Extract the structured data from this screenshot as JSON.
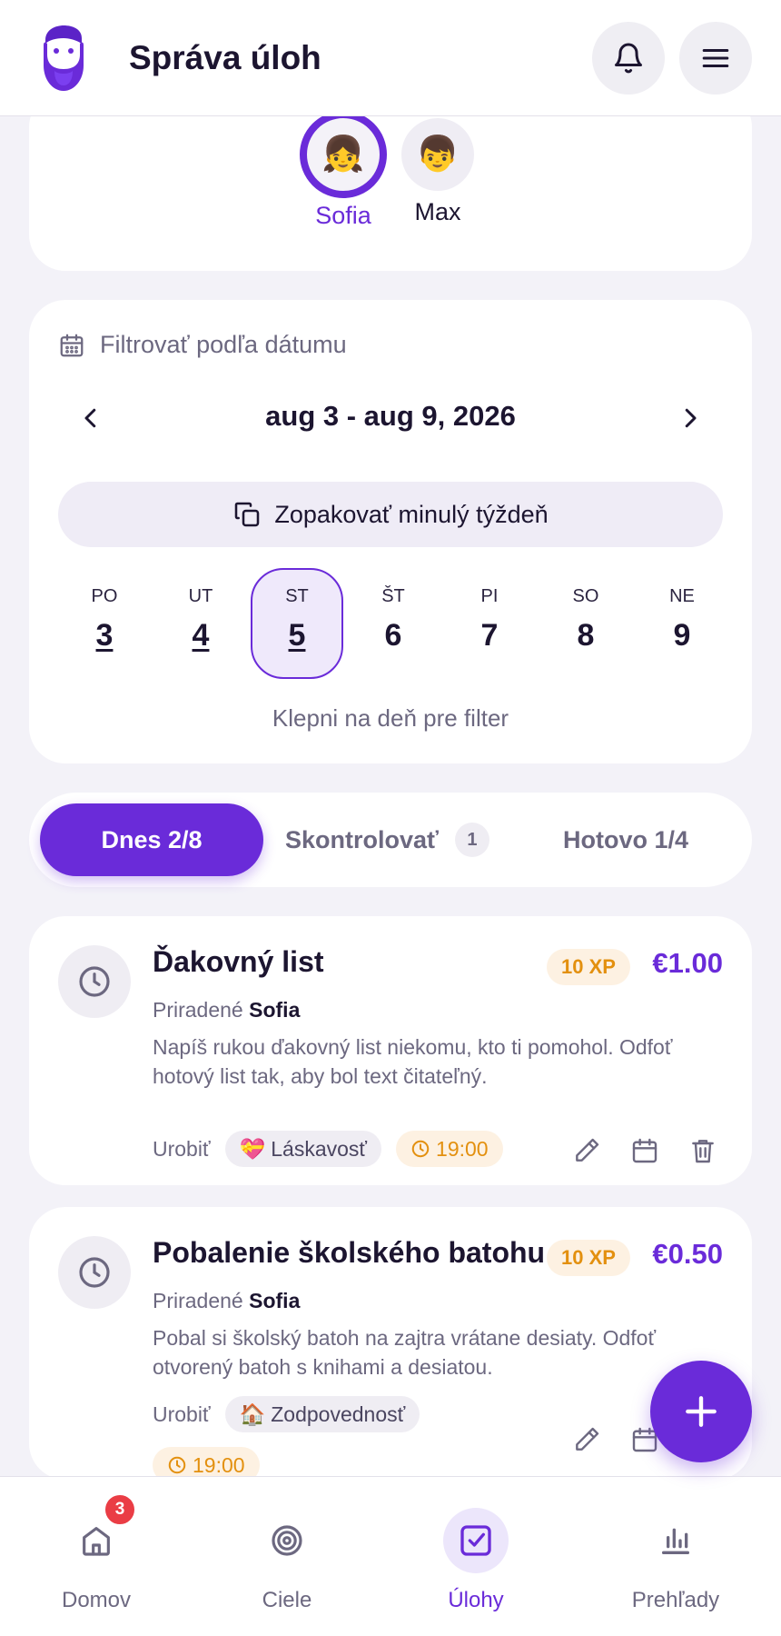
{
  "header": {
    "title": "Správa úloh",
    "icons": [
      "logo-bearded-face",
      "bell-icon",
      "menu-icon"
    ]
  },
  "profiles": [
    {
      "name": "Sofia",
      "emoji": "👧",
      "selected": true
    },
    {
      "name": "Max",
      "emoji": "👦",
      "selected": false
    }
  ],
  "filter": {
    "label": "Filtrovať podľa dátumu",
    "week_range": "aug 3 - aug 9, 2026",
    "repeat_label": "Zopakovať minulý týždeň",
    "days": [
      {
        "abbr": "PO",
        "num": "3"
      },
      {
        "abbr": "UT",
        "num": "4"
      },
      {
        "abbr": "ST",
        "num": "5"
      },
      {
        "abbr": "ŠT",
        "num": "6"
      },
      {
        "abbr": "PI",
        "num": "7"
      },
      {
        "abbr": "SO",
        "num": "8"
      },
      {
        "abbr": "NE",
        "num": "9"
      }
    ],
    "selected_day": "5",
    "hint": "Klepni na deň pre filter"
  },
  "tabs": {
    "today": "Dnes 2/8",
    "review": "Skontrolovať",
    "review_count": "1",
    "done": "Hotovo 1/4"
  },
  "tasks": [
    {
      "title": "Ďakovný list",
      "xp": "10 XP",
      "price": "€1.00",
      "assigned_label": "Priradené",
      "assigned_to": "Sofia",
      "description": "Napíš rukou ďakovný list niekomu, kto ti pomohol. Odfoť hotový list tak, aby bol text čitateľný.",
      "status": "Urobiť",
      "category_emoji": "💝",
      "category": "Láskavosť",
      "time": "19:00"
    },
    {
      "title": "Pobalenie školského batohu",
      "xp": "10 XP",
      "price": "€0.50",
      "assigned_label": "Priradené",
      "assigned_to": "Sofia",
      "description": "Pobal si školský batoh na zajtra vrátane desiaty. Odfoť otvorený batoh s knihami a desiatou.",
      "status": "Urobiť",
      "category_emoji": "🏠",
      "category": "Zodpovednosť",
      "time": "19:00"
    }
  ],
  "bottom_nav": {
    "home": "Domov",
    "home_badge": "3",
    "goals": "Ciele",
    "tasks": "Úlohy",
    "reports": "Prehľady"
  },
  "colors": {
    "accent": "#6a2bd9",
    "xp": "#e3900f",
    "badge": "#ea3d45"
  }
}
